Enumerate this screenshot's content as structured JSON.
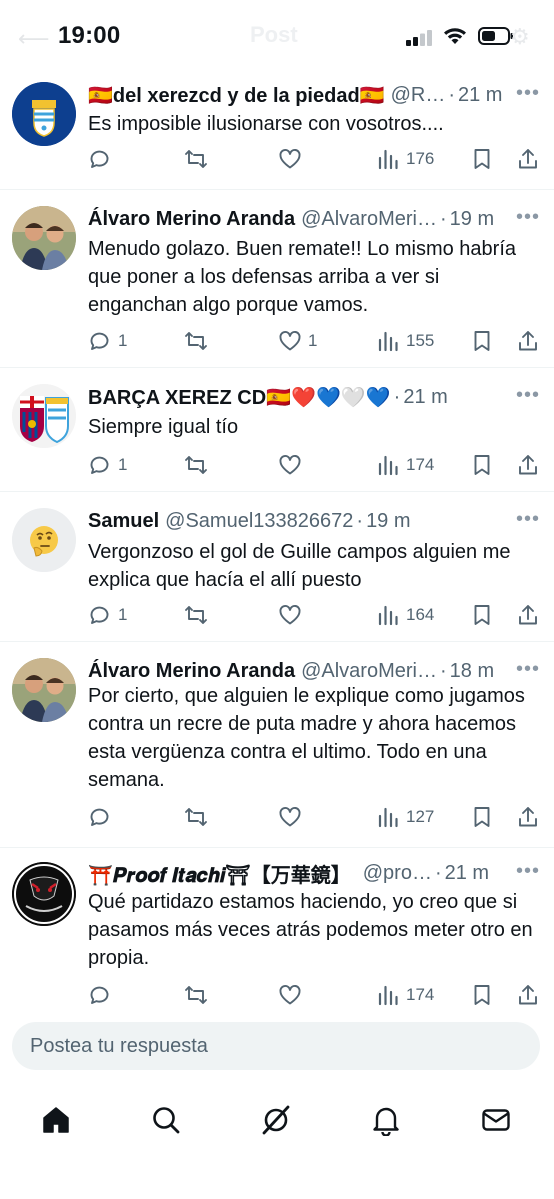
{
  "status_bar": {
    "time": "19:00",
    "ghost_title": "Post"
  },
  "tweets": [
    {
      "display_name": "🇪🇸del xerezcd y de la piedad🇪🇸",
      "handle": "@R…",
      "time": "21 m",
      "text": "Es imposible ilusionarse con vosotros....",
      "replies": "",
      "reposts": "",
      "likes": "",
      "views": "176",
      "avatar_icon": "xerez-crest-avatar"
    },
    {
      "display_name": "Álvaro Merino Aranda",
      "handle": "@AlvaroMeri…",
      "time": "19 m",
      "text": "Menudo golazo. Buen remate!! Lo mismo habría que poner a los defensas arriba a ver si enganchan algo porque vamos.",
      "replies": "1",
      "reposts": "",
      "likes": "1",
      "views": "155",
      "avatar_icon": "two-people-photo-avatar"
    },
    {
      "display_name": "BARÇA XEREZ CD🇪🇸❤️💙🤍💙",
      "handle": "",
      "time": "21 m",
      "text": "Siempre igual tío",
      "replies": "1",
      "reposts": "",
      "likes": "",
      "views": "174",
      "avatar_icon": "barca-xerez-crest-avatar"
    },
    {
      "display_name": "Samuel",
      "handle": "@Samuel133826672",
      "time": "19 m",
      "text": "Vergonzoso el gol de Guille campos alguien me explica que hacía el allí puesto",
      "replies": "1",
      "reposts": "",
      "likes": "",
      "views": "164",
      "avatar_icon": "thinking-face-avatar"
    },
    {
      "display_name": "Álvaro Merino Aranda",
      "handle": "@AlvaroMeri…",
      "time": "18 m",
      "text": "Por cierto, que alguien le explique como jugamos contra un recre de puta madre y ahora hacemos esta vergüenza contra el ultimo. Todo en una semana.",
      "replies": "",
      "reposts": "",
      "likes": "",
      "views": "127",
      "avatar_icon": "two-people-photo-avatar"
    },
    {
      "display_name": "⛩️𝑷𝒓𝒐𝒐𝒇 𝑰𝒕𝒂𝒄𝒉𝒊⛩【万華鏡】",
      "handle": "@pro…",
      "time": "21 m",
      "text": "Qué partidazo estamos haciendo, yo creo que si pasamos más veces atrás podemos meter otro en propia.",
      "replies": "",
      "reposts": "",
      "likes": "",
      "views": "174",
      "avatar_icon": "itachi-avatar"
    }
  ],
  "reply_bar": {
    "placeholder": "Postea tu respuesta"
  },
  "nav": {
    "items": [
      "home-icon",
      "search-icon",
      "grok-icon",
      "notifications-icon",
      "messages-icon"
    ]
  },
  "colors": {
    "text": "#0f1419",
    "secondary": "#536471",
    "divider": "#eff3f4",
    "input_bg": "#eff3f4"
  }
}
